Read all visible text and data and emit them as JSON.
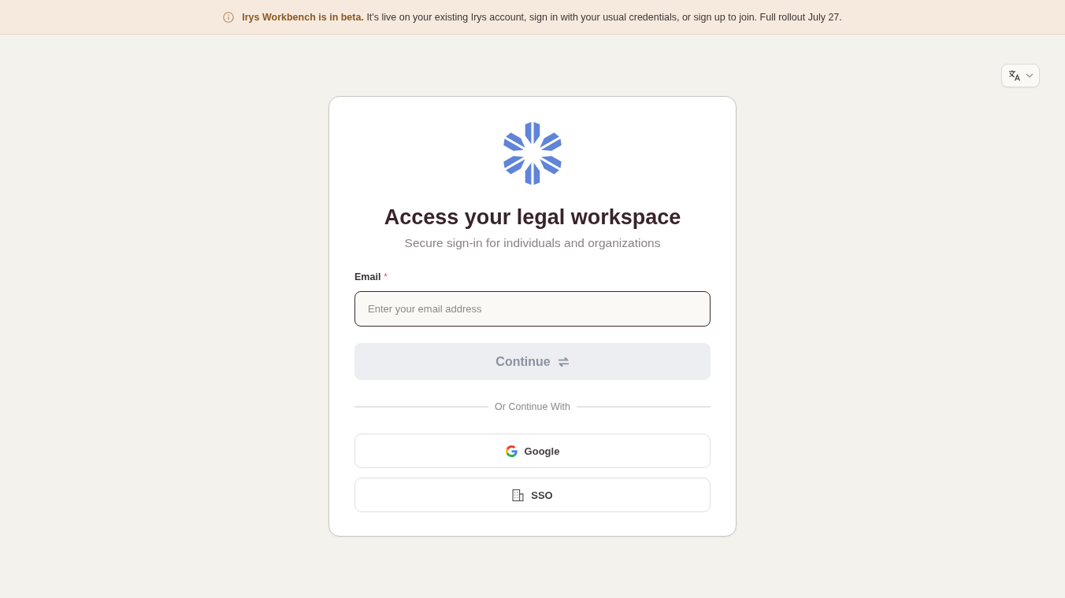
{
  "banner": {
    "text": "**Irys Workbench is in beta.** It's live on your existing Irys account, sign in with your usual credentials, or sign up to join. Full rollout July 27."
  },
  "card": {
    "title": "Access your legal workspace",
    "subtitle": "Secure sign-in for individuals and organizations",
    "email": {
      "label": "Email",
      "required_mark": "*",
      "placeholder": "Enter your email address"
    },
    "continue_button": {
      "label": "Continue",
      "disabled": true
    },
    "divider": "Or Continue With",
    "providers": [
      {
        "kind": "google",
        "label": "Google"
      },
      {
        "kind": "sso",
        "label": "SSO"
      }
    ]
  }
}
